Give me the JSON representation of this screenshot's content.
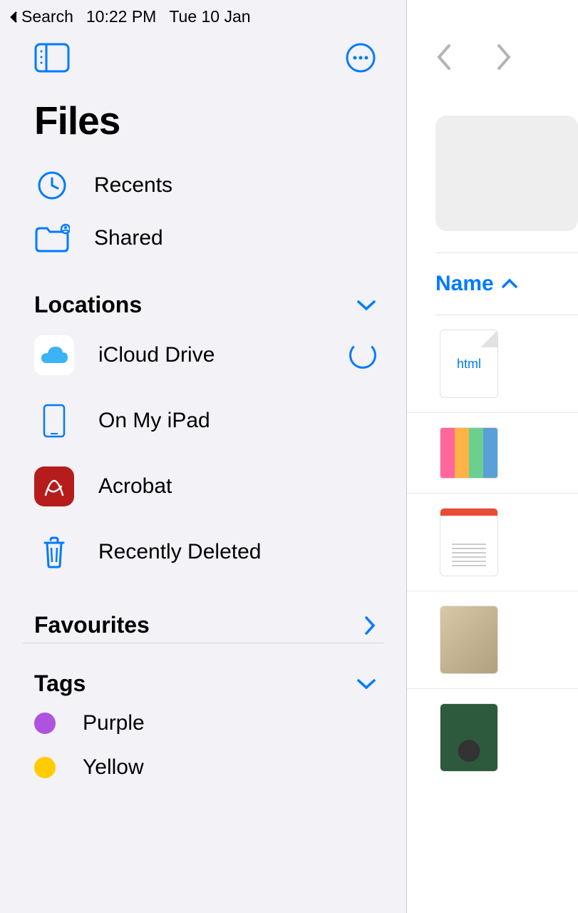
{
  "status": {
    "back_label": "Search",
    "time": "10:22 PM",
    "date": "Tue 10 Jan"
  },
  "title": "Files",
  "nav": {
    "recents": "Recents",
    "shared": "Shared"
  },
  "sections": {
    "locations": "Locations",
    "favourites": "Favourites",
    "tags": "Tags"
  },
  "locations": {
    "icloud": "iCloud Drive",
    "ipad": "On My iPad",
    "acrobat": "Acrobat",
    "deleted": "Recently Deleted"
  },
  "tags": {
    "purple": {
      "label": "Purple",
      "color": "#af52de"
    },
    "yellow": {
      "label": "Yellow",
      "color": "#ffcc00"
    }
  },
  "content": {
    "sort_label": "Name",
    "files": [
      {
        "type": "html",
        "thumb_text": "html"
      },
      {
        "type": "image"
      },
      {
        "type": "pdf"
      },
      {
        "type": "image"
      },
      {
        "type": "image"
      }
    ]
  },
  "colors": {
    "accent": "#007aff",
    "sidebar_bg": "#f2f2f7"
  }
}
